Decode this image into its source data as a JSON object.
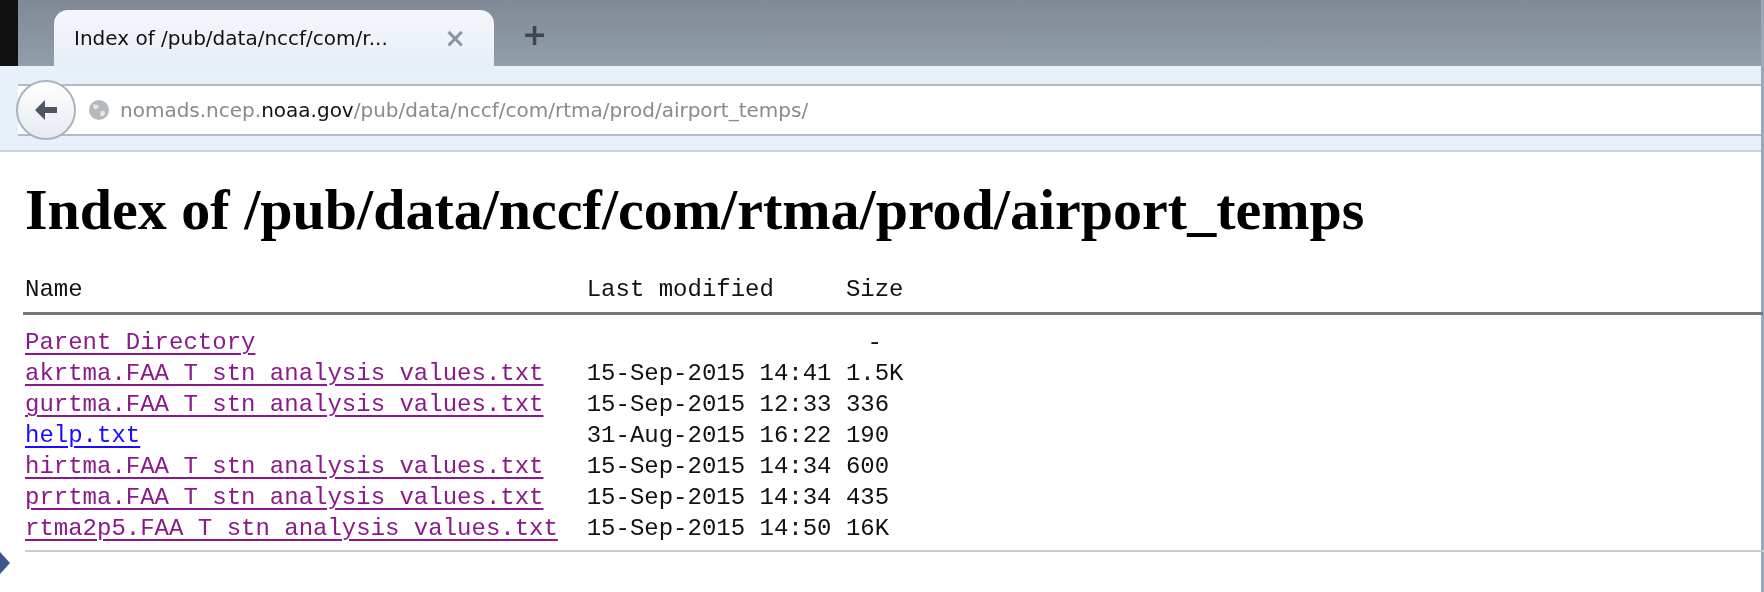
{
  "tab": {
    "title": "Index of /pub/data/nccf/com/r...",
    "close": "×"
  },
  "new_tab": "+",
  "address": {
    "host_prefix": "nomads.ncep.",
    "domain": "noaa.gov",
    "path": "/pub/data/nccf/com/rtma/prod/airport_temps/"
  },
  "heading": "Index of /pub/data/nccf/com/rtma/prod/airport_temps",
  "table": {
    "columns": [
      "Name",
      "Last modified",
      "Size"
    ],
    "rows": [
      {
        "name": "Parent Directory",
        "visited": true,
        "modified": "",
        "size": "-"
      },
      {
        "name": "akrtma.FAA T stn analysis values.txt",
        "visited": true,
        "modified": "15-Sep-2015 14:41",
        "size": "1.5K"
      },
      {
        "name": "gurtma.FAA T stn analysis values.txt",
        "visited": true,
        "modified": "15-Sep-2015 12:33",
        "size": "336"
      },
      {
        "name": "help.txt",
        "visited": false,
        "modified": "31-Aug-2015 16:22",
        "size": "190"
      },
      {
        "name": "hirtma.FAA T stn analysis values.txt",
        "visited": true,
        "modified": "15-Sep-2015 14:34",
        "size": "600"
      },
      {
        "name": "prrtma.FAA T stn analysis values.txt",
        "visited": true,
        "modified": "15-Sep-2015 14:34",
        "size": "435"
      },
      {
        "name": "rtma2p5.FAA T stn analysis values.txt",
        "visited": true,
        "modified": "15-Sep-2015 14:50",
        "size": "16K"
      }
    ]
  }
}
